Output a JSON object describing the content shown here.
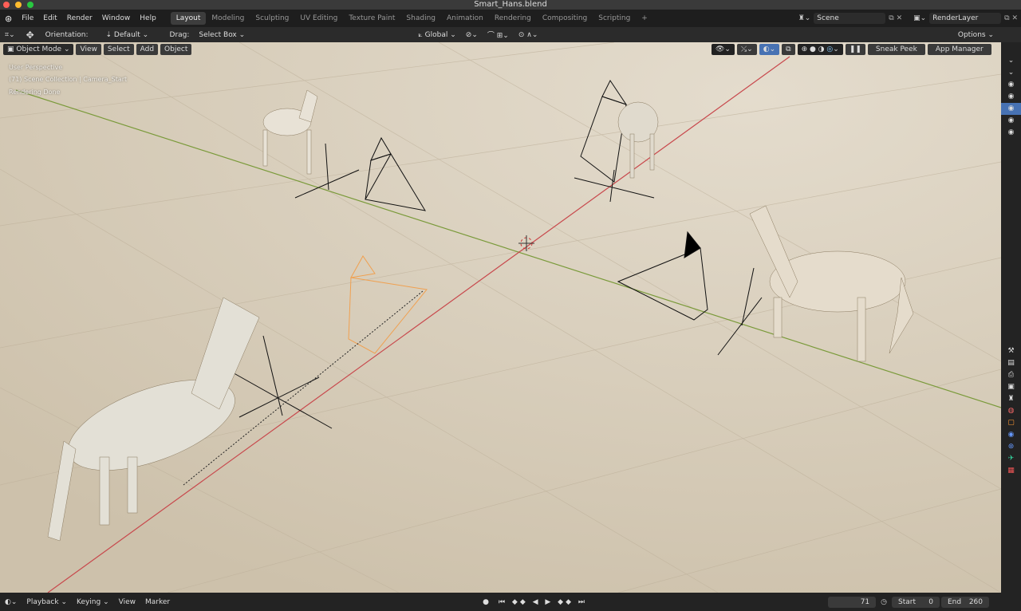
{
  "window": {
    "title": "Smart_Hans.blend"
  },
  "menu": [
    "File",
    "Edit",
    "Render",
    "Window",
    "Help"
  ],
  "workspaces": [
    "Layout",
    "Modeling",
    "Sculpting",
    "UV Editing",
    "Texture Paint",
    "Shading",
    "Animation",
    "Rendering",
    "Compositing",
    "Scripting",
    "+"
  ],
  "scene": {
    "scene_name": "Scene",
    "view_layer": "RenderLayer"
  },
  "toolbar": {
    "orientation_label": "Orientation:",
    "orientation_value": "Default",
    "drag_label": "Drag:",
    "drag_value": "Select Box",
    "transform_orientation": "Global",
    "options": "Options"
  },
  "viewport_header": {
    "mode": "Object Mode",
    "view": "View",
    "select": "Select",
    "add": "Add",
    "object": "Object",
    "sneak_peek": "Sneak Peek",
    "app_manager": "App Manager"
  },
  "overlay": {
    "line1": "User Perspective",
    "line2": "(71) Scene Collection | Camera_Start",
    "line3": "Rendering Done"
  },
  "timeline": {
    "playback": "Playback",
    "keying": "Keying",
    "view": "View",
    "marker": "Marker",
    "current_frame": "71",
    "start_label": "Start",
    "start": "0",
    "end_label": "End",
    "end": "260"
  },
  "colors": {
    "accent": "#4772b3",
    "floor": "#d6cbb8",
    "x_axis": "#c8484c",
    "y_axis": "#7a9a3a",
    "selected": "#f0a050"
  }
}
